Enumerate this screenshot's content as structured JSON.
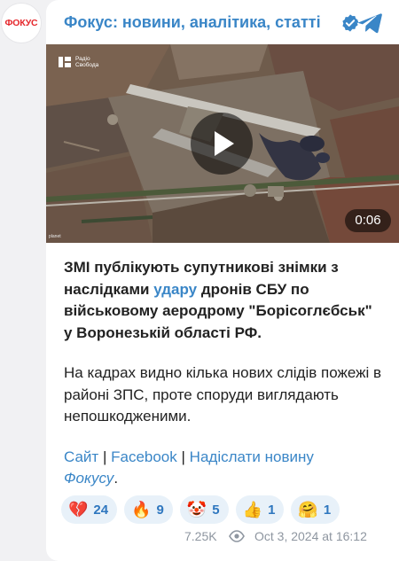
{
  "avatar": {
    "label": "ФОКУС"
  },
  "channel": {
    "title": "Фокус: новини, аналітика, статті"
  },
  "video": {
    "duration": "0:06",
    "watermark_line1": "Радіо",
    "watermark_line2": "Свобода",
    "tag": "planet"
  },
  "post": {
    "p1_before": "ЗМІ публікують супутникові знімки з наслідками ",
    "p1_link": "удару",
    "p1_after": " дронів СБУ по військовому аеродрому \"Борісоглєбськ\" у Воронезькій області РФ.",
    "p2": "На кадрах видно кілька нових слідів пожежі в районі ЗПС, проте споруди виглядають непошкодженими.",
    "link_site": "Сайт",
    "separator": "|",
    "link_facebook": "Facebook",
    "link_submit": "Надіслати новину",
    "link_focus": "Фокусу",
    "period": "."
  },
  "reactions": [
    {
      "emoji": "💔",
      "count": "24",
      "icon": "broken-heart-icon"
    },
    {
      "emoji": "🔥",
      "count": "9",
      "icon": "fire-icon"
    },
    {
      "emoji": "🤡",
      "count": "5",
      "icon": "clown-face-icon"
    },
    {
      "emoji": "👍",
      "count": "1",
      "icon": "thumbs-up-icon"
    },
    {
      "emoji": "🤗",
      "count": "1",
      "icon": "hugging-face-icon"
    }
  ],
  "footer": {
    "views": "7.25K",
    "timestamp": "Oct 3, 2024 at 16:12"
  },
  "colors": {
    "accent": "#3a86c7",
    "brand_red": "#e5262b",
    "reaction_bg": "#e8f1f9",
    "meta_gray": "#8e96a0"
  }
}
